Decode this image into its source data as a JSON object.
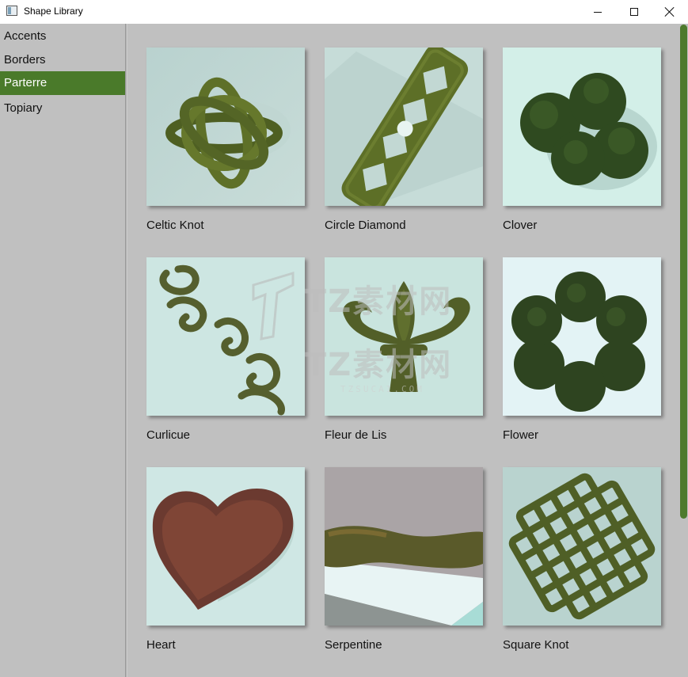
{
  "window": {
    "title": "Shape Library",
    "accent_color": "#4a7a2a"
  },
  "sidebar": {
    "items": [
      {
        "label": "Accents",
        "selected": false
      },
      {
        "label": "Borders",
        "selected": false
      },
      {
        "label": "Parterre",
        "selected": true
      },
      {
        "label": "Topiary",
        "selected": false
      }
    ]
  },
  "library": {
    "items": [
      {
        "label": "Celtic Knot",
        "thumbnail": "hedge-celtic-knot"
      },
      {
        "label": "Circle Diamond",
        "thumbnail": "hedge-circle-diamond"
      },
      {
        "label": "Clover",
        "thumbnail": "hedge-clover"
      },
      {
        "label": "Curlicue",
        "thumbnail": "hedge-curlicue"
      },
      {
        "label": "Fleur de Lis",
        "thumbnail": "hedge-fleur-de-lis"
      },
      {
        "label": "Flower",
        "thumbnail": "hedge-flower"
      },
      {
        "label": "Heart",
        "thumbnail": "hedge-heart"
      },
      {
        "label": "Serpentine",
        "thumbnail": "hedge-serpentine"
      },
      {
        "label": "Square Knot",
        "thumbnail": "hedge-square-knot"
      }
    ]
  },
  "watermark": {
    "text": "TZ素材网",
    "text2": "TZ素材网",
    "url": "TZSUCAI.COM"
  }
}
